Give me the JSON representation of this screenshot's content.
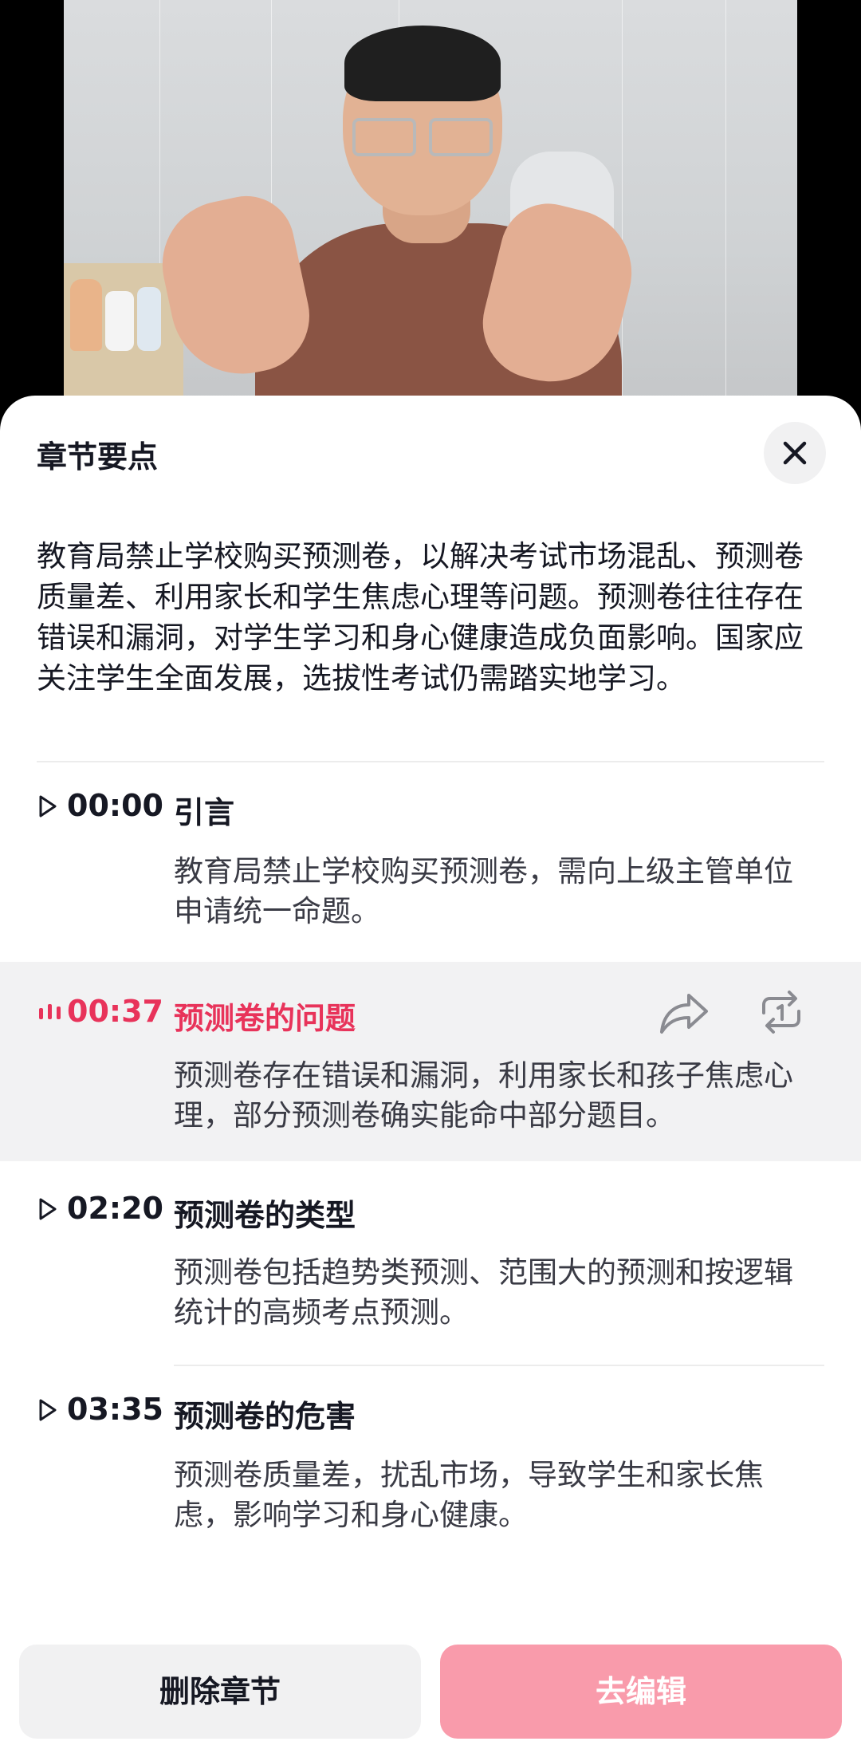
{
  "sheet": {
    "title": "章节要点",
    "summary": "教育局禁止学校购买预测卷，以解决考试市场混乱、预测卷质量差、利用家长和学生焦虑心理等问题。预测卷往往存在错误和漏洞，对学生学习和身心健康造成负面影响。国家应关注学生全面发展，选拔性考试仍需踏实地学习。"
  },
  "chapters": [
    {
      "time": "00:00",
      "title": "引言",
      "desc": "教育局禁止学校购买预测卷，需向上级主管单位申请统一命题。",
      "active": false
    },
    {
      "time": "00:37",
      "title": "预测卷的问题",
      "desc": "预测卷存在错误和漏洞，利用家长和孩子焦虑心理，部分预测卷确实能命中部分题目。",
      "active": true
    },
    {
      "time": "02:20",
      "title": "预测卷的类型",
      "desc": "预测卷包括趋势类预测、范围大的预测和按逻辑统计的高频考点预测。",
      "active": false
    },
    {
      "time": "03:35",
      "title": "预测卷的危害",
      "desc": "预测卷质量差，扰乱市场，导致学生和家长焦虑，影响学习和身心健康。",
      "active": false
    }
  ],
  "buttons": {
    "delete_label": "删除章节",
    "edit_label": "去编辑"
  },
  "colors": {
    "accent": "#e8335a",
    "edit_button": "#f99bab",
    "active_row_bg": "#f2f2f3"
  },
  "icons": {
    "close": "close-icon",
    "play": "play-triangle-icon",
    "playing": "playing-bars-icon",
    "share": "share-icon",
    "loop": "loop-once-icon"
  }
}
